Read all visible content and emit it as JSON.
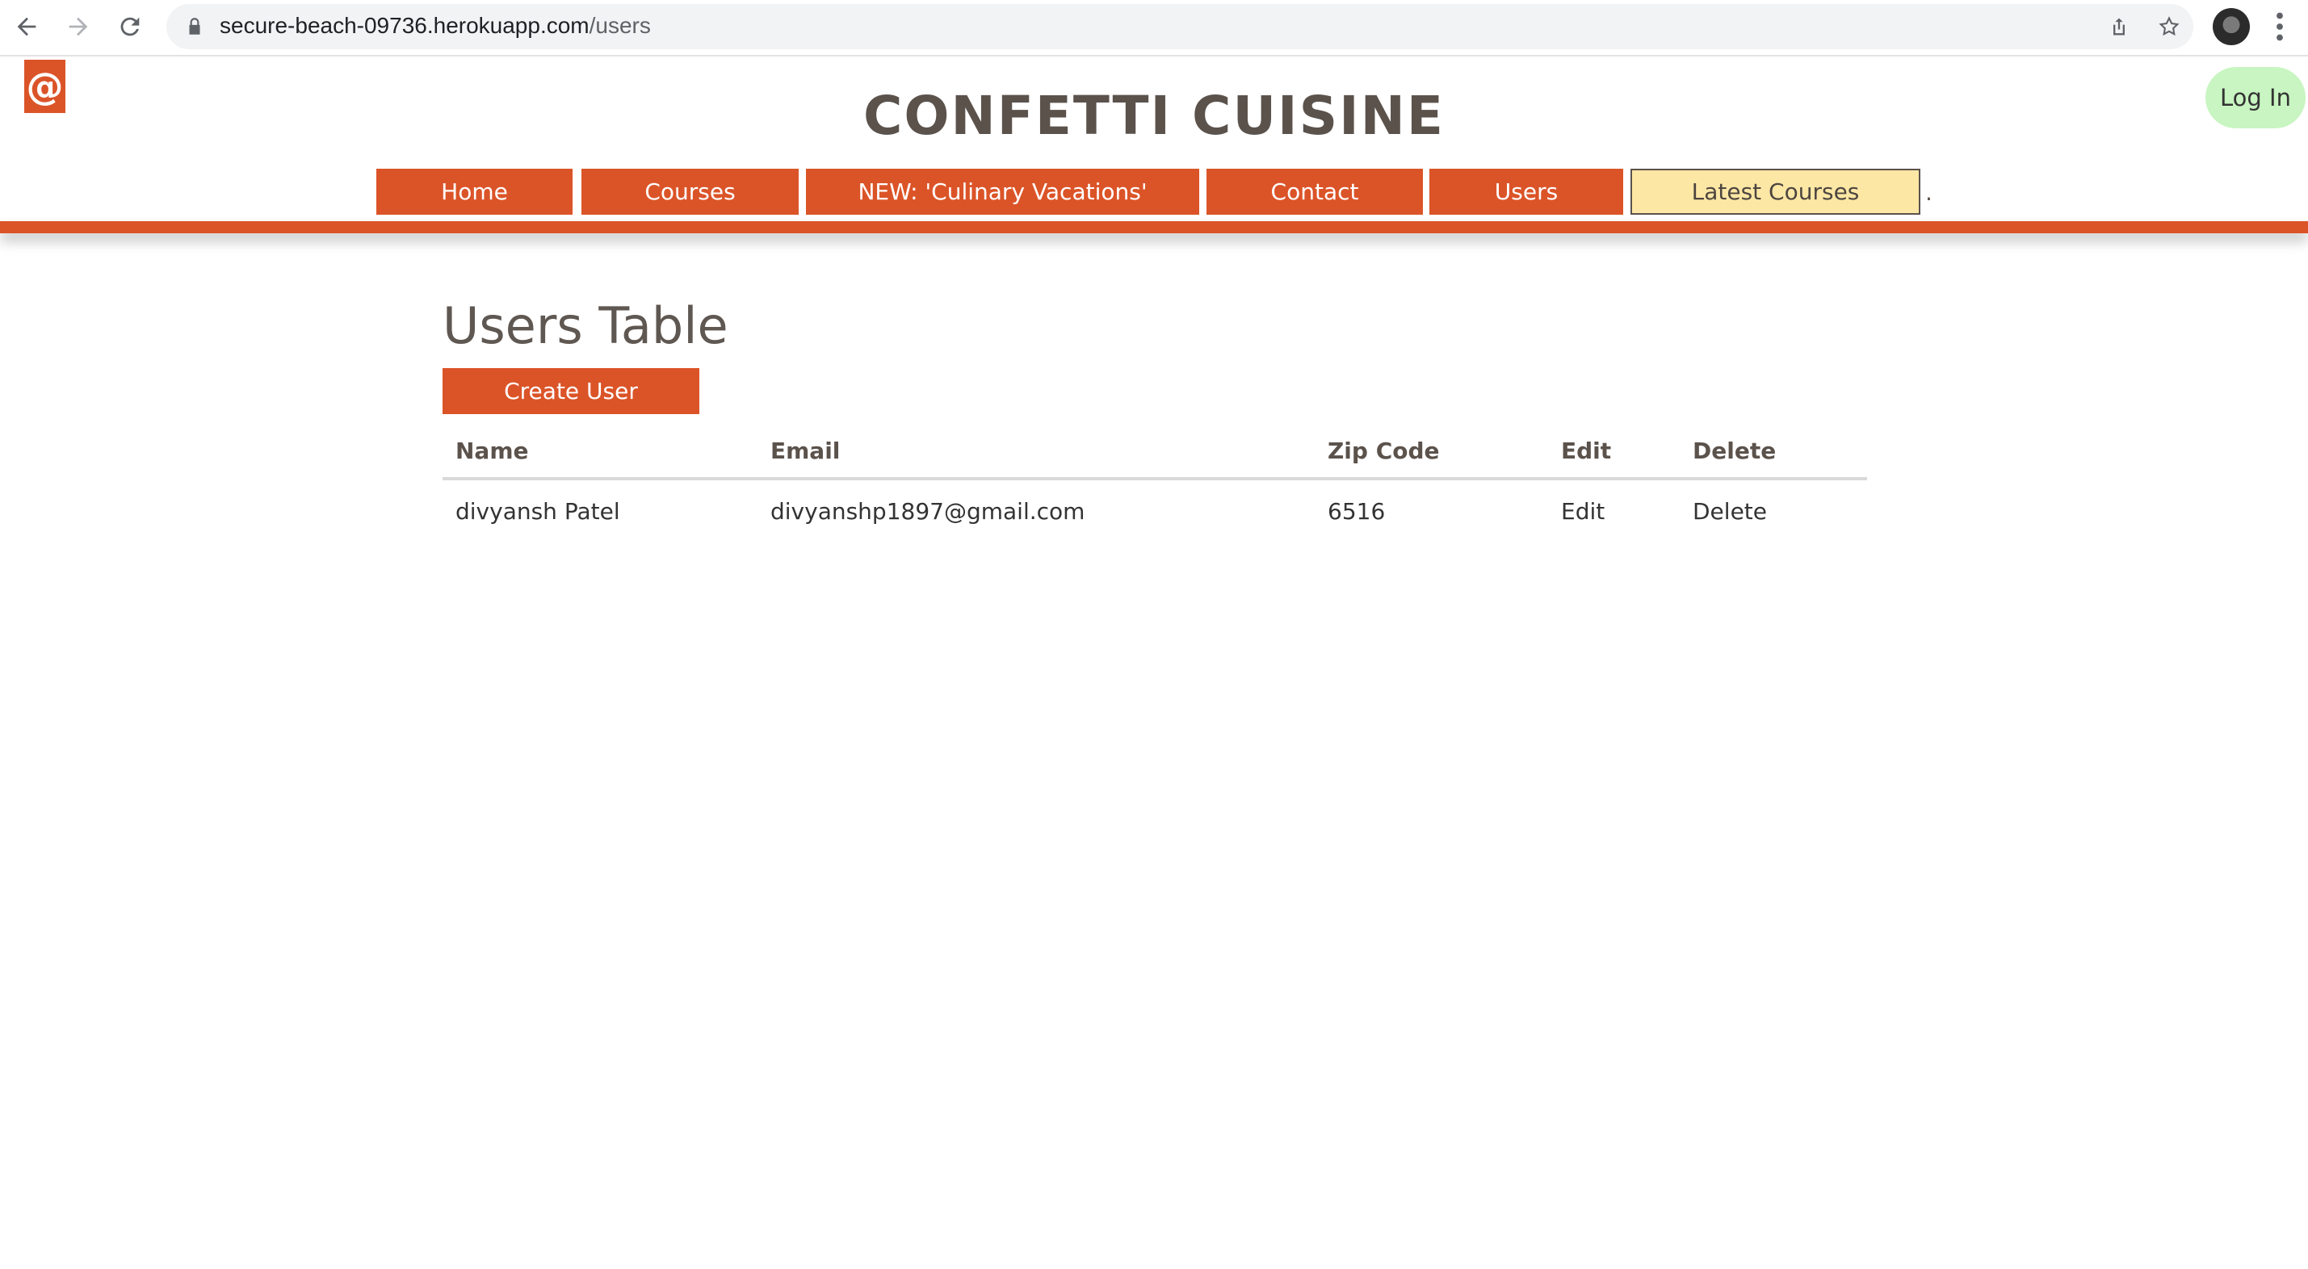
{
  "browser": {
    "url_host": "secure-beach-09736.herokuapp.com",
    "url_path": "/users"
  },
  "header": {
    "logo_glyph": "@",
    "site_title": "CONFETTI CUISINE",
    "login_label": "Log In",
    "nav": [
      {
        "label": "Home"
      },
      {
        "label": "Courses"
      },
      {
        "label": "NEW: 'Culinary Vacations'"
      },
      {
        "label": "Contact"
      },
      {
        "label": "Users"
      },
      {
        "label": "Latest Courses"
      }
    ],
    "nav_trailing": "."
  },
  "main": {
    "page_title": "Users Table",
    "create_button": "Create User",
    "table": {
      "columns": [
        "Name",
        "Email",
        "Zip Code",
        "Edit",
        "Delete"
      ],
      "rows": [
        {
          "name": "divyansh Patel",
          "email": "divyanshp1897@gmail.com",
          "zip": "6516",
          "edit": "Edit",
          "delete": "Delete"
        }
      ]
    }
  },
  "colors": {
    "brand": "#db5428",
    "highlight_nav": "#fde7a5",
    "login_bg": "#c8f5c1",
    "text": "#5f5751"
  }
}
